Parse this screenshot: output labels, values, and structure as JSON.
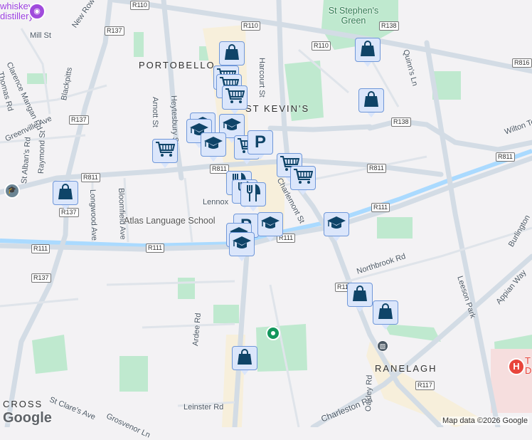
{
  "map": {
    "attribution": "Map data ©2026 Google",
    "logo": "Google",
    "areas": [
      "PORTOBELLO",
      "ST KEVIN'S",
      "RANELAGH",
      "CROSS",
      "St Stephen's Green",
      "Atlas Language School"
    ],
    "streets": [
      "Mill St",
      "New Row",
      "Clarence Mangan Rd",
      "Thomas Rd",
      "Blackpitts",
      "Greenville Ave",
      "St Alban's Rd",
      "Raymond St",
      "Arnott St",
      "Heytesbury St",
      "Harcourt St",
      "Longwood Ave",
      "Bloomfield Ave",
      "Lennox",
      "Charlemont St",
      "Quinn's Ln",
      "Wilton Te",
      "Northbrook Rd",
      "Leeson Park",
      "Appian Way",
      "Burlington",
      "Charleston Rd",
      "Oakley Rd",
      "Ardee Rd",
      "Leinster Rd",
      "St Clare's Ave",
      "Grosvenor Ln"
    ],
    "road_shields": [
      "R110",
      "R110",
      "R110",
      "R137",
      "R137",
      "R137",
      "R137",
      "R138",
      "R138",
      "R816",
      "R811",
      "R811",
      "R811",
      "R811",
      "R111",
      "R111",
      "R111",
      "R111",
      "R111",
      "R117"
    ],
    "pois": {
      "distillery": "whiskey\ndistillery",
      "hospital_letter": "H",
      "hospital_partial": "T\nD"
    },
    "markers": [
      "shop",
      "shop",
      "cart",
      "cart",
      "cart",
      "shop",
      "grad",
      "grad",
      "grad",
      "grad",
      "cart",
      "parking",
      "cart",
      "shop",
      "cart",
      "cart",
      "food",
      "food",
      "food",
      "parking",
      "grad",
      "grad",
      "grad",
      "grad",
      "shop",
      "shop",
      "shop"
    ],
    "colors": {
      "marker_fill": "#dbe6fb",
      "marker_border": "#6f97d9",
      "marker_icon": "#0f4468",
      "park": "#a8e6c1",
      "canal": "#aadaff",
      "hospital": "#e8453c"
    }
  }
}
